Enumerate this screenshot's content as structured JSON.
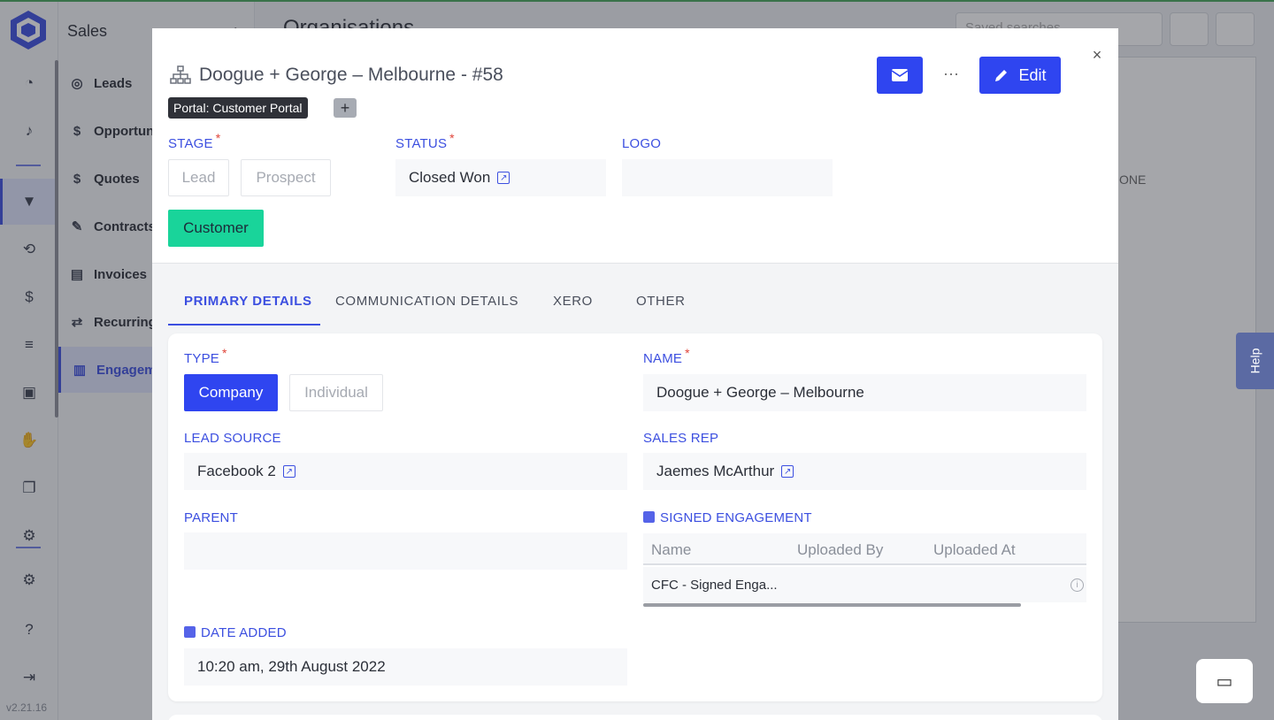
{
  "app": {
    "section_title": "Sales",
    "page_title": "Organisations",
    "version": "v2.21.16",
    "help_label": "Help",
    "nav_items": [
      {
        "label": "Leads"
      },
      {
        "label": "Opportun"
      },
      {
        "label": "Quotes"
      },
      {
        "label": "Contracts"
      },
      {
        "label": "Invoices"
      },
      {
        "label": "Recurring"
      },
      {
        "label": "Engagem"
      }
    ],
    "bg_search_placeholder": "Saved searches",
    "bg_column": "ONE"
  },
  "modal": {
    "title": "Doogue + George – Melbourne - #58",
    "portal_tag": "Portal: Customer Portal",
    "portal_add": "+",
    "edit_label": "Edit",
    "more_label": "···",
    "close_label": "×",
    "stage": {
      "label": "STAGE",
      "required_mark": "*",
      "options": [
        "Lead",
        "Prospect",
        "Customer"
      ],
      "selected": "Customer"
    },
    "status": {
      "label": "STATUS",
      "required_mark": "*",
      "value": "Closed Won"
    },
    "logo": {
      "label": "LOGO"
    },
    "tabs": [
      {
        "label": "PRIMARY DETAILS"
      },
      {
        "label": "COMMUNICATION DETAILS"
      },
      {
        "label": "XERO"
      },
      {
        "label": "OTHER"
      }
    ],
    "type": {
      "label": "TYPE",
      "required_mark": "*",
      "options": [
        "Company",
        "Individual"
      ],
      "selected": "Company"
    },
    "name": {
      "label": "NAME",
      "required_mark": "*",
      "value": "Doogue + George – Melbourne"
    },
    "lead_source": {
      "label": "LEAD SOURCE",
      "value": "Facebook 2"
    },
    "sales_rep": {
      "label": "SALES REP",
      "value": "Jaemes McArthur"
    },
    "parent": {
      "label": "PARENT",
      "value": ""
    },
    "signed_engagement": {
      "label": "SIGNED ENGAGEMENT",
      "columns": [
        "Name",
        "Uploaded By",
        "Uploaded At"
      ],
      "rows": [
        {
          "name": "CFC - Signed Enga...",
          "uploaded_by": "",
          "uploaded_at": ""
        }
      ]
    },
    "date_added": {
      "label": "DATE ADDED",
      "value": "10:20 am, 29th August 2022"
    }
  },
  "colors": {
    "accent": "#2f45f0",
    "label": "#3c4fe0",
    "stage_selected": "#19d49a",
    "required": "#e0453a"
  }
}
